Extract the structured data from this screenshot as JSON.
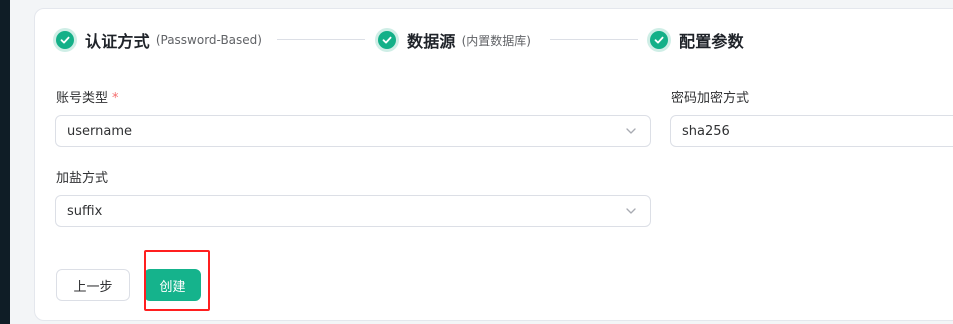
{
  "steps": [
    {
      "title": "认证方式",
      "subtitle": "(Password-Based)",
      "status": "complete"
    },
    {
      "title": "数据源",
      "subtitle": "(内置数据库)",
      "status": "complete"
    },
    {
      "title": "配置参数",
      "subtitle": "",
      "status": "complete"
    }
  ],
  "form": {
    "account_type": {
      "label": "账号类型",
      "required_mark": "*",
      "value": "username"
    },
    "password_encryption": {
      "label": "密码加密方式",
      "value": "sha256"
    },
    "salt_method": {
      "label": "加盐方式",
      "value": "suffix"
    }
  },
  "actions": {
    "prev_label": "上一步",
    "create_label": "创建"
  },
  "colors": {
    "accent": "#15b38c",
    "highlight": "#ff1f1f"
  },
  "icons": {
    "step_complete": "check-circle-icon",
    "select_arrow": "chevron-down-icon"
  }
}
